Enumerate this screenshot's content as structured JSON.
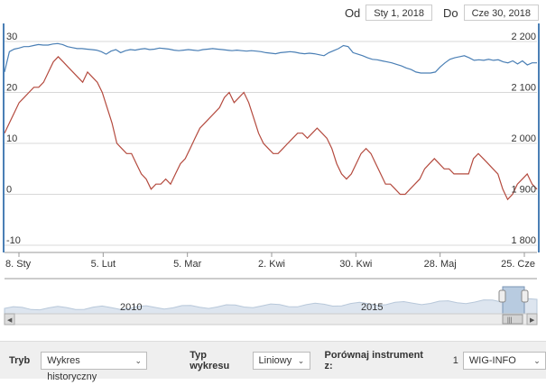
{
  "date_range": {
    "from_label": "Od",
    "from_value": "Sty 1, 2018",
    "to_label": "Do",
    "to_value": "Cze 30, 2018"
  },
  "chart_data": {
    "type": "line",
    "x_ticks": [
      "8. Sty",
      "5. Lut",
      "5. Mar",
      "2. Kwi",
      "30. Kwi",
      "28. Maj",
      "25. Cze"
    ],
    "left_axis": {
      "ticks": [
        "30",
        "20",
        "10",
        "0",
        "-10"
      ],
      "range": [
        -10,
        30
      ]
    },
    "right_axis": {
      "ticks": [
        "2 200",
        "2 100",
        "2 000",
        "1 900",
        "1 800"
      ],
      "range": [
        1800,
        2200
      ]
    },
    "series": [
      {
        "axis": "right",
        "color": "#4a7fb5",
        "values": [
          2140,
          2180,
          2185,
          2187,
          2190,
          2190,
          2192,
          2194,
          2193,
          2193,
          2195,
          2196,
          2194,
          2190,
          2188,
          2186,
          2186,
          2185,
          2184,
          2183,
          2180,
          2175,
          2181,
          2184,
          2178,
          2182,
          2184,
          2183,
          2185,
          2186,
          2184,
          2185,
          2187,
          2186,
          2185,
          2183,
          2182,
          2183,
          2184,
          2183,
          2182,
          2184,
          2185,
          2186,
          2185,
          2184,
          2183,
          2182,
          2183,
          2182,
          2181,
          2182,
          2181,
          2180,
          2178,
          2177,
          2176,
          2178,
          2179,
          2180,
          2179,
          2177,
          2176,
          2177,
          2176,
          2174,
          2172,
          2178,
          2182,
          2186,
          2192,
          2190,
          2178,
          2175,
          2172,
          2168,
          2165,
          2164,
          2162,
          2160,
          2158,
          2155,
          2152,
          2148,
          2145,
          2140,
          2138,
          2138,
          2138,
          2140,
          2150,
          2158,
          2165,
          2168,
          2170,
          2172,
          2168,
          2163,
          2164,
          2163,
          2165,
          2163,
          2164,
          2160,
          2158,
          2162,
          2156,
          2162,
          2154,
          2158,
          2158
        ]
      },
      {
        "axis": "left",
        "color": "#b44a3e",
        "values": [
          12,
          14,
          16,
          18,
          19,
          20,
          21,
          21,
          22,
          24,
          26,
          27,
          26,
          25,
          24,
          23,
          22,
          24,
          23,
          22,
          20,
          17,
          14,
          10,
          9,
          8,
          8,
          6,
          4,
          3,
          1,
          2,
          2,
          3,
          2,
          4,
          6,
          7,
          9,
          11,
          13,
          14,
          15,
          16,
          17,
          19,
          20,
          18,
          19,
          20,
          18,
          15,
          12,
          10,
          9,
          8,
          8,
          9,
          10,
          11,
          12,
          12,
          11,
          12,
          13,
          12,
          11,
          9,
          6,
          4,
          3,
          4,
          6,
          8,
          9,
          8,
          6,
          4,
          2,
          2,
          1,
          0,
          0,
          1,
          2,
          3,
          5,
          6,
          7,
          6,
          5,
          5,
          4,
          4,
          4,
          4,
          7,
          8,
          7,
          6,
          5,
          4,
          1,
          -1,
          0,
          2,
          3,
          4,
          2,
          1
        ]
      }
    ]
  },
  "navigator": {
    "year_labels": [
      "2010",
      "2015"
    ],
    "left_arrow": "◀",
    "right_arrow": "▶",
    "scroll_grip": "|||"
  },
  "toolbar": {
    "mode_label": "Tryb",
    "mode_value": "Wykres historyczny",
    "type_label": "Typ wykresu",
    "type_value": "Liniowy",
    "compare_label": "Porównaj instrument z:",
    "compare_index": "1",
    "compare_value": "WIG-INFO",
    "dropdown_arrow": "⌄"
  }
}
